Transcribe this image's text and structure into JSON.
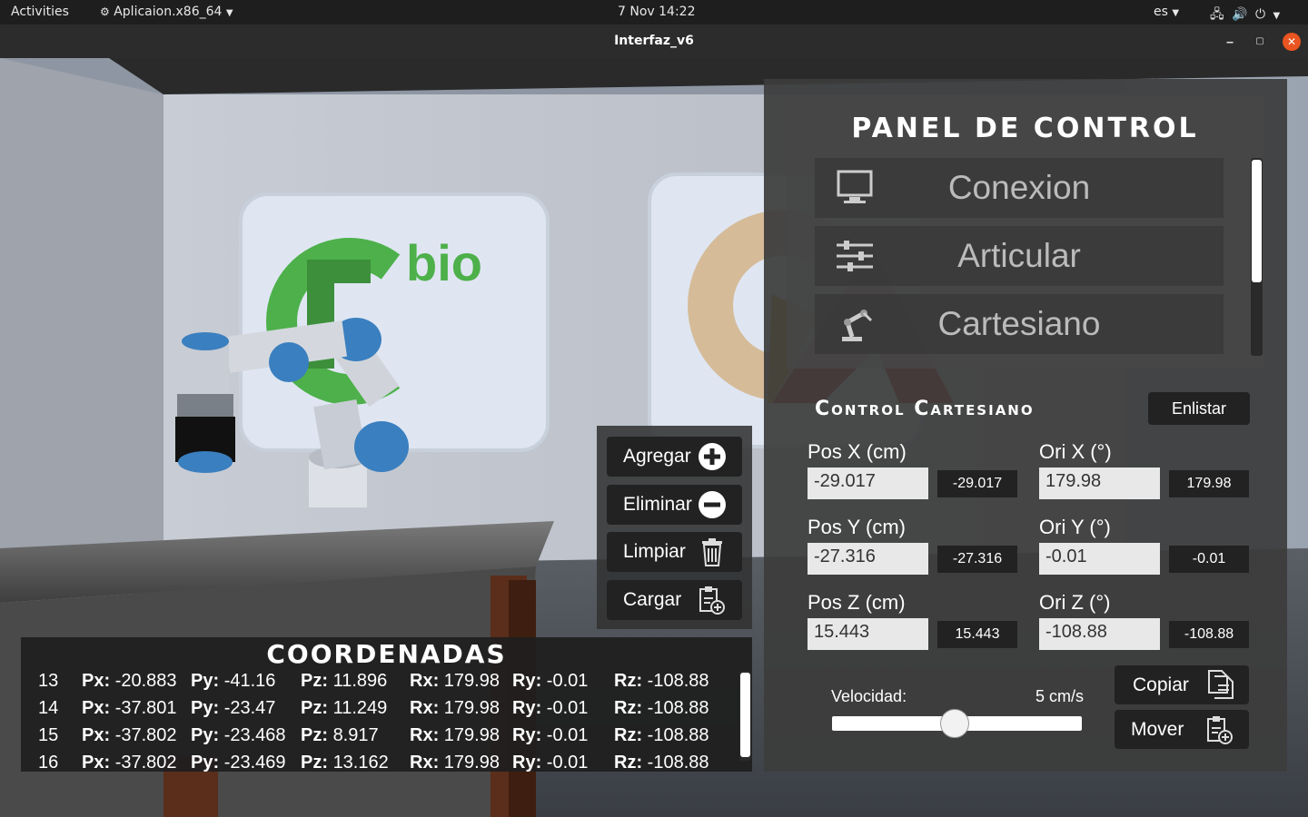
{
  "topbar": {
    "activities": "Activities",
    "app_name": "Aplicaion.x86_64",
    "datetime": "7 Nov  14:22",
    "lang": "es"
  },
  "window": {
    "title": "Interfaz_v6"
  },
  "scene": {
    "logo_text": "bio"
  },
  "control_panel": {
    "title": "PANEL DE CONTROL",
    "menu": [
      {
        "label": "Conexion",
        "icon": "monitor-icon"
      },
      {
        "label": "Articular",
        "icon": "sliders-icon"
      },
      {
        "label": "Cartesiano",
        "icon": "robot-arm-icon"
      }
    ]
  },
  "cartesian": {
    "title": "Control Cartesiano",
    "enlist_label": "Enlistar",
    "fields": [
      {
        "label": "Pos X (cm)",
        "value": "-29.017",
        "readout": "-29.017"
      },
      {
        "label": "Ori X (°)",
        "value": "179.98",
        "readout": "179.98"
      },
      {
        "label": "Pos Y (cm)",
        "value": "-27.316",
        "readout": "-27.316"
      },
      {
        "label": "Ori Y (°)",
        "value": "-0.01",
        "readout": "-0.01"
      },
      {
        "label": "Pos Z (cm)",
        "value": "15.443",
        "readout": "15.443"
      },
      {
        "label": "Ori Z (°)",
        "value": "-108.88",
        "readout": "-108.88"
      }
    ],
    "speed_label": "Velocidad:",
    "speed_value": "5 cm/s",
    "speed_fraction": 0.49,
    "copy_label": "Copiar",
    "move_label": "Mover"
  },
  "list_buttons": {
    "add": "Agregar",
    "remove": "Eliminar",
    "clear": "Limpiar",
    "load": "Cargar"
  },
  "coordinates": {
    "title": "COORDENADAS",
    "keys": [
      "Px:",
      "Py:",
      "Pz:",
      "Rx:",
      "Ry:",
      "Rz:"
    ],
    "rows": [
      {
        "n": "13",
        "px": "-20.883",
        "py": "-41.16",
        "pz": "11.896",
        "rx": "179.98",
        "ry": "-0.01",
        "rz": "-108.88"
      },
      {
        "n": "14",
        "px": "-37.801",
        "py": "-23.47",
        "pz": "11.249",
        "rx": "179.98",
        "ry": "-0.01",
        "rz": "-108.88"
      },
      {
        "n": "15",
        "px": "-37.802",
        "py": "-23.468",
        "pz": "8.917",
        "rx": "179.98",
        "ry": "-0.01",
        "rz": "-108.88"
      },
      {
        "n": "16",
        "px": "-37.802",
        "py": "-23.469",
        "pz": "13.162",
        "rx": "179.98",
        "ry": "-0.01",
        "rz": "-108.88"
      }
    ]
  },
  "colors": {
    "logo_green": "#4db04a",
    "accent_red": "#b21c1c",
    "accent_gold": "#c49a1e",
    "close_button": "#e95420"
  }
}
